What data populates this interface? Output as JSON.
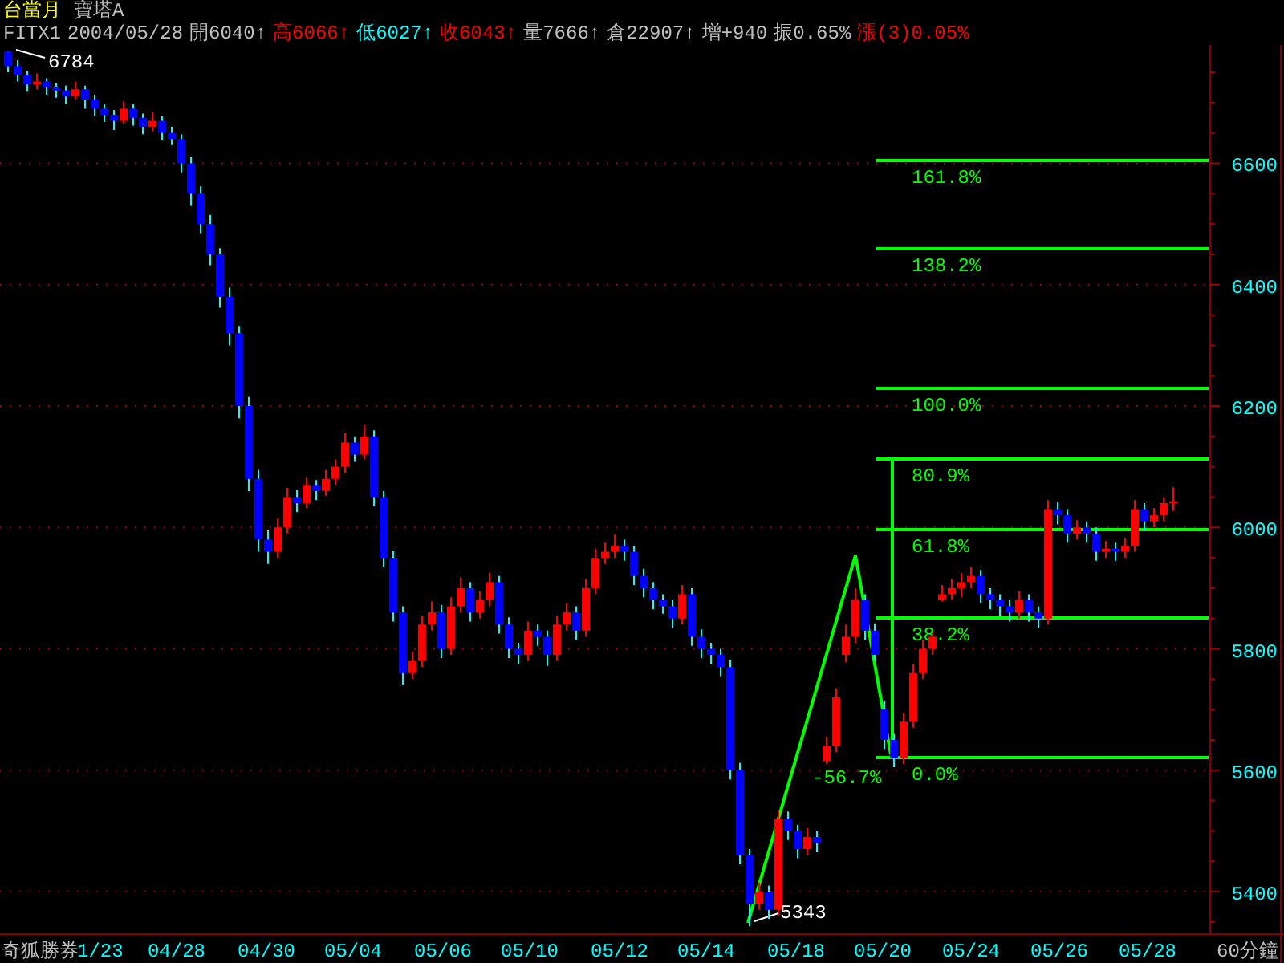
{
  "header": {
    "contract": "台當月",
    "indicator": "寶塔A",
    "items": [
      {
        "text": "FITX1",
        "color": "#c0c0c0"
      },
      {
        "text": "2004/05/28",
        "color": "#c0c0c0"
      },
      {
        "text": "開6040↑",
        "color": "#c0c0c0"
      },
      {
        "text": "高6066↑",
        "color": "#ff0000"
      },
      {
        "text": "低6027↑",
        "color": "#00ffff"
      },
      {
        "text": "收6043↑",
        "color": "#ff0000"
      },
      {
        "text": "量7666↑",
        "color": "#c0c0c0"
      },
      {
        "text": "倉22907↑",
        "color": "#c0c0c0"
      },
      {
        "text": "增+940",
        "color": "#c0c0c0"
      },
      {
        "text": "振0.65%",
        "color": "#c0c0c0"
      },
      {
        "text": "漲(3)0.05%",
        "color": "#ff0000"
      }
    ]
  },
  "chart": {
    "chart_data": {
      "type": "candlestick",
      "ylim": [
        5330,
        6795
      ],
      "yticks": [
        6600,
        6400,
        6200,
        6000,
        5800,
        5600,
        5400
      ],
      "grid": true,
      "ohlc": [
        [
          6784,
          6784,
          6750,
          6760
        ],
        [
          6760,
          6770,
          6735,
          6745
        ],
        [
          6745,
          6752,
          6718,
          6730
        ],
        [
          6730,
          6748,
          6722,
          6735
        ],
        [
          6735,
          6740,
          6712,
          6725
        ],
        [
          6725,
          6732,
          6708,
          6720
        ],
        [
          6720,
          6728,
          6698,
          6710
        ],
        [
          6710,
          6735,
          6705,
          6722
        ],
        [
          6722,
          6728,
          6690,
          6705
        ],
        [
          6705,
          6712,
          6678,
          6690
        ],
        [
          6690,
          6698,
          6668,
          6680
        ],
        [
          6680,
          6688,
          6655,
          6670
        ],
        [
          6670,
          6702,
          6665,
          6690
        ],
        [
          6690,
          6698,
          6662,
          6675
        ],
        [
          6675,
          6682,
          6648,
          6660
        ],
        [
          6660,
          6685,
          6652,
          6670
        ],
        [
          6670,
          6678,
          6638,
          6650
        ],
        [
          6650,
          6660,
          6630,
          6640
        ],
        [
          6640,
          6648,
          6585,
          6600
        ],
        [
          6600,
          6610,
          6530,
          6550
        ],
        [
          6550,
          6562,
          6485,
          6500
        ],
        [
          6500,
          6515,
          6432,
          6450
        ],
        [
          6450,
          6460,
          6362,
          6380
        ],
        [
          6380,
          6395,
          6300,
          6320
        ],
        [
          6320,
          6332,
          6180,
          6200
        ],
        [
          6200,
          6215,
          6060,
          6080
        ],
        [
          6080,
          6095,
          5960,
          5980
        ],
        [
          5980,
          5995,
          5940,
          5960
        ],
        [
          5960,
          6015,
          5950,
          6000
        ],
        [
          6000,
          6065,
          5990,
          6050
        ],
        [
          6050,
          6062,
          6025,
          6040
        ],
        [
          6040,
          6082,
          6032,
          6070
        ],
        [
          6070,
          6078,
          6045,
          6060
        ],
        [
          6060,
          6095,
          6052,
          6080
        ],
        [
          6080,
          6112,
          6070,
          6100
        ],
        [
          6100,
          6155,
          6090,
          6140
        ],
        [
          6140,
          6150,
          6108,
          6120
        ],
        [
          6120,
          6170,
          6112,
          6150
        ],
        [
          6150,
          6160,
          6035,
          6050
        ],
        [
          6050,
          6060,
          5935,
          5950
        ],
        [
          5950,
          5962,
          5845,
          5860
        ],
        [
          5860,
          5870,
          5740,
          5760
        ],
        [
          5760,
          5795,
          5750,
          5780
        ],
        [
          5780,
          5855,
          5770,
          5840
        ],
        [
          5840,
          5878,
          5830,
          5860
        ],
        [
          5860,
          5872,
          5785,
          5800
        ],
        [
          5800,
          5885,
          5790,
          5870
        ],
        [
          5870,
          5918,
          5860,
          5900
        ],
        [
          5900,
          5910,
          5845,
          5860
        ],
        [
          5860,
          5895,
          5850,
          5880
        ],
        [
          5880,
          5925,
          5870,
          5910
        ],
        [
          5910,
          5920,
          5825,
          5840
        ],
        [
          5840,
          5852,
          5785,
          5800
        ],
        [
          5800,
          5810,
          5775,
          5790
        ],
        [
          5790,
          5845,
          5780,
          5830
        ],
        [
          5830,
          5840,
          5805,
          5820
        ],
        [
          5820,
          5830,
          5772,
          5790
        ],
        [
          5790,
          5855,
          5780,
          5840
        ],
        [
          5840,
          5875,
          5830,
          5860
        ],
        [
          5860,
          5870,
          5815,
          5830
        ],
        [
          5830,
          5915,
          5820,
          5900
        ],
        [
          5900,
          5965,
          5890,
          5950
        ],
        [
          5950,
          5975,
          5940,
          5960
        ],
        [
          5960,
          5988,
          5950,
          5970
        ],
        [
          5970,
          5980,
          5945,
          5960
        ],
        [
          5960,
          5970,
          5905,
          5920
        ],
        [
          5920,
          5932,
          5885,
          5900
        ],
        [
          5900,
          5910,
          5865,
          5880
        ],
        [
          5880,
          5890,
          5858,
          5870
        ],
        [
          5870,
          5880,
          5835,
          5850
        ],
        [
          5850,
          5905,
          5840,
          5890
        ],
        [
          5890,
          5900,
          5805,
          5820
        ],
        [
          5820,
          5832,
          5785,
          5800
        ],
        [
          5800,
          5810,
          5775,
          5790
        ],
        [
          5790,
          5800,
          5755,
          5770
        ],
        [
          5770,
          5782,
          5585,
          5600
        ],
        [
          5600,
          5612,
          5445,
          5460
        ],
        [
          5460,
          5470,
          5343,
          5380
        ],
        [
          5380,
          5415,
          5370,
          5400
        ],
        [
          5400,
          5410,
          5355,
          5370
        ],
        [
          5370,
          5535,
          5360,
          5520
        ],
        [
          5520,
          5532,
          5485,
          5500
        ],
        [
          5500,
          5510,
          5455,
          5470
        ],
        [
          5470,
          5505,
          5460,
          5490
        ],
        [
          5490,
          5500,
          5465,
          5480
        ],
        [
          5615,
          5655,
          5610,
          5640
        ],
        [
          5640,
          5735,
          5630,
          5720
        ],
        [
          5790,
          5840,
          5778,
          5820
        ],
        [
          5820,
          5900,
          5810,
          5880
        ],
        [
          5880,
          5890,
          5815,
          5830
        ],
        [
          5830,
          5842,
          5780,
          5790
        ],
        [
          5700,
          5715,
          5635,
          5650
        ],
        [
          5650,
          5660,
          5605,
          5620
        ],
        [
          5620,
          5695,
          5610,
          5680
        ],
        [
          5680,
          5775,
          5670,
          5760
        ],
        [
          5760,
          5815,
          5750,
          5800
        ],
        [
          5800,
          5828,
          5790,
          5820
        ],
        [
          5880,
          5905,
          5878,
          5890
        ],
        [
          5890,
          5915,
          5880,
          5900
        ],
        [
          5900,
          5925,
          5885,
          5910
        ],
        [
          5910,
          5935,
          5900,
          5920
        ],
        [
          5920,
          5930,
          5875,
          5890
        ],
        [
          5890,
          5900,
          5865,
          5880
        ],
        [
          5880,
          5890,
          5855,
          5870
        ],
        [
          5870,
          5880,
          5845,
          5860
        ],
        [
          5860,
          5895,
          5850,
          5880
        ],
        [
          5880,
          5890,
          5845,
          5860
        ],
        [
          5860,
          5870,
          5835,
          5850
        ],
        [
          5850,
          6045,
          5840,
          6030
        ],
        [
          6030,
          6042,
          6005,
          6020
        ],
        [
          6020,
          6030,
          5975,
          5990
        ],
        [
          5990,
          6012,
          5980,
          6000
        ],
        [
          6000,
          6010,
          5975,
          5990
        ],
        [
          5990,
          6000,
          5945,
          5960
        ],
        [
          5960,
          5978,
          5950,
          5965
        ],
        [
          5965,
          5975,
          5945,
          5960
        ],
        [
          5960,
          5982,
          5950,
          5970
        ],
        [
          5970,
          6045,
          5960,
          6030
        ],
        [
          6030,
          6040,
          5995,
          6010
        ],
        [
          6010,
          6032,
          6000,
          6020
        ],
        [
          6020,
          6050,
          6010,
          6040
        ],
        [
          6040,
          6066,
          6027,
          6043
        ]
      ]
    },
    "y_axis": [
      "6600",
      "6400",
      "6200",
      "6000",
      "5800",
      "5600",
      "5400"
    ],
    "fib_levels": [
      "161.8%",
      "138.2%",
      "100.0%",
      "80.9%",
      "61.8%",
      "38.2%",
      "0.0%"
    ],
    "retrace_label": "-56.7%",
    "high_label": "6784",
    "low_label": "5343"
  },
  "x_axis": {
    "brand": "奇狐勝券",
    "labels": [
      "1/23",
      "04/28",
      "04/30",
      "05/04",
      "05/06",
      "05/10",
      "05/12",
      "05/14",
      "05/18",
      "05/20",
      "05/24",
      "05/26",
      "05/28"
    ],
    "period": "60分鐘"
  }
}
